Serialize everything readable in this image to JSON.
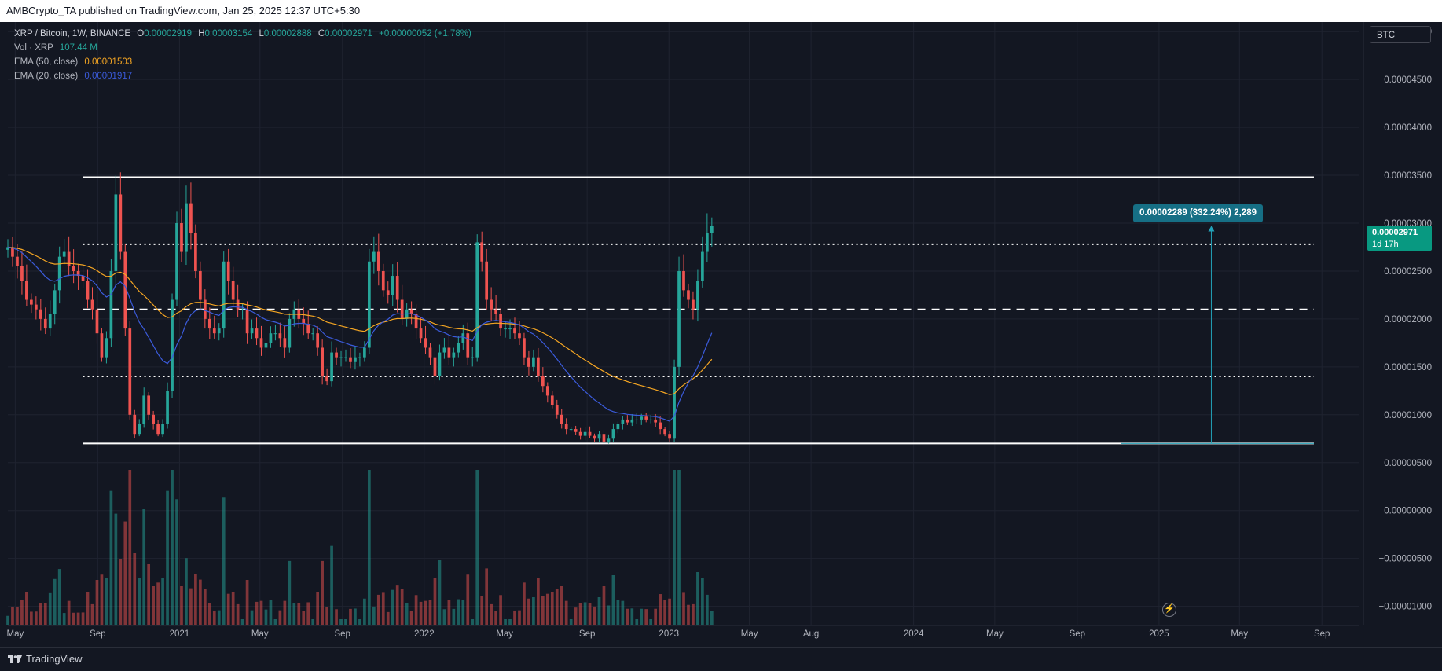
{
  "header": {
    "published": "AMBCrypto_TA published on TradingView.com, Jan 25, 2025 12:37 UTC+5:30"
  },
  "legend": {
    "symbol": "XRP / Bitcoin, 1W, BINANCE",
    "open_label": "O",
    "open": "0.00002919",
    "high_label": "H",
    "high": "0.00003154",
    "low_label": "L",
    "low": "0.00002888",
    "close_label": "C",
    "close": "0.00002971",
    "change": "+0.00000052 (+1.78%)",
    "vol_label": "Vol · XRP",
    "vol": "107.44 M",
    "ema50_label": "EMA (50, close)",
    "ema50": "0.00001503",
    "ema20_label": "EMA (20, close)",
    "ema20": "0.00001917"
  },
  "currency_button": "BTC",
  "price_tag": {
    "price": "0.00002971",
    "countdown": "1d 17h"
  },
  "measure": {
    "label": "0.00002289 (332.24%) 2,289",
    "value": 2.289e-05,
    "percent": 332.24,
    "bars": 2289
  },
  "footer": {
    "brand": "TradingView"
  },
  "colors": {
    "up": "#26a69a",
    "down": "#ef5350",
    "ema50": "#f5a623",
    "ema20": "#3b5bdb",
    "background": "#131722",
    "measure": "#22a2b9"
  },
  "chart_data": {
    "type": "candlestick",
    "title": "XRP / Bitcoin, 1W, BINANCE",
    "ylim": [
      -1.2e-05,
      5.1e-05
    ],
    "y_ticks": [
      "0.00005000",
      "0.00004500",
      "0.00004000",
      "0.00003500",
      "0.00003000",
      "0.00002500",
      "0.00002000",
      "0.00001500",
      "0.00001000",
      "0.00000500",
      "0.00000000",
      "−0.00000500",
      "−0.00001000"
    ],
    "y_tick_values": [
      5e-05,
      4.5e-05,
      4e-05,
      3.5e-05,
      3e-05,
      2.5e-05,
      2e-05,
      1.5e-05,
      1e-05,
      5e-06,
      0,
      -5e-06,
      -1e-05
    ],
    "x_range": [
      "2020-04-20",
      "2025-10-27"
    ],
    "x_ticks": [
      {
        "label": "May",
        "date": "2020-05-01"
      },
      {
        "label": "Sep",
        "date": "2020-09-01"
      },
      {
        "label": "2021",
        "date": "2021-01-01"
      },
      {
        "label": "May",
        "date": "2021-05-01"
      },
      {
        "label": "Sep",
        "date": "2021-09-01"
      },
      {
        "label": "2022",
        "date": "2022-01-01"
      },
      {
        "label": "May",
        "date": "2022-05-01"
      },
      {
        "label": "Sep",
        "date": "2022-09-01"
      },
      {
        "label": "2023",
        "date": "2023-01-01"
      },
      {
        "label": "May",
        "date": "2023-05-01"
      },
      {
        "label": "Aug",
        "date": "2023-08-01"
      },
      {
        "label": "2024",
        "date": "2024-01-01"
      },
      {
        "label": "May",
        "date": "2024-05-01"
      },
      {
        "label": "Sep",
        "date": "2024-09-01"
      },
      {
        "label": "2025",
        "date": "2025-01-01"
      },
      {
        "label": "May",
        "date": "2025-05-01"
      },
      {
        "label": "Sep",
        "date": "2025-09-01"
      }
    ],
    "series_dates": {
      "start": "2020-04-20",
      "interval": "1W"
    },
    "closes": [
      2.75e-05,
      2.65e-05,
      2.55e-05,
      2.4e-05,
      2.2e-05,
      2.15e-05,
      2.1e-05,
      2e-05,
      1.9e-05,
      2.05e-05,
      2.3e-05,
      2.65e-05,
      2.7e-05,
      2.55e-05,
      2.5e-05,
      2.45e-05,
      2.4e-05,
      2.2e-05,
      2.1e-05,
      1.85e-05,
      1.6e-05,
      1.8e-05,
      2.5e-05,
      3.3e-05,
      2.7e-05,
      1.9e-05,
      1e-05,
      8e-06,
      9e-06,
      1.2e-05,
      1e-05,
      9e-06,
      8e-06,
      9e-06,
      1.25e-05,
      2.2e-05,
      3e-05,
      2.7e-05,
      3.2e-05,
      2.9e-05,
      2.5e-05,
      2.2e-05,
      2e-05,
      1.9e-05,
      1.85e-05,
      1.9e-05,
      2.6e-05,
      2.4e-05,
      2.2e-05,
      2.1e-05,
      2.1e-05,
      1.85e-05,
      1.9e-05,
      1.8e-05,
      1.7e-05,
      1.75e-05,
      1.85e-05,
      1.85e-05,
      1.8e-05,
      1.7e-05,
      2e-05,
      2.1e-05,
      2e-05,
      1.95e-05,
      1.85e-05,
      1.85e-05,
      1.7e-05,
      1.4e-05,
      1.35e-05,
      1.65e-05,
      1.6e-05,
      1.6e-05,
      1.6e-05,
      1.55e-05,
      1.6e-05,
      1.6e-05,
      1.7e-05,
      2.6e-05,
      2.7e-05,
      2.5e-05,
      2.3e-05,
      2.25e-05,
      2.45e-05,
      2.2e-05,
      2e-05,
      2.1e-05,
      2.05e-05,
      1.9e-05,
      1.8e-05,
      1.7e-05,
      1.6e-05,
      1.4e-05,
      1.65e-05,
      1.7e-05,
      1.6e-05,
      1.65e-05,
      1.75e-05,
      1.85e-05,
      1.6e-05,
      1.6e-05,
      2.8e-05,
      2.6e-05,
      2.2e-05,
      2.1e-05,
      2.05e-05,
      1.9e-05,
      1.9e-05,
      1.9e-05,
      1.85e-05,
      1.8e-05,
      1.6e-05,
      1.5e-05,
      1.6e-05,
      1.4e-05,
      1.3e-05,
      1.2e-05,
      1.1e-05,
      1e-05,
      9e-06,
      8.5e-06,
      8.5e-06,
      8.2e-06,
      7.8e-06,
      8.2e-06,
      7.8e-06,
      7.5e-06,
      8e-06,
      7.2e-06,
      7.5e-06,
      8.5e-06,
      9e-06,
      9.5e-06,
      9.2e-06,
      9.5e-06,
      9.5e-06,
      9.8e-06,
      9.5e-06,
      9.5e-06,
      9.2e-06,
      8.5e-06,
      8e-06,
      7.5e-06,
      1.5e-05,
      2.5e-05,
      2.3e-05,
      2.2e-05,
      2.1e-05,
      2.4e-05,
      2.7e-05,
      2.9e-05,
      2.971e-05
    ],
    "ema50_end": 1.503e-05,
    "ema20_end": 1.917e-05,
    "horizontal_levels": [
      {
        "value": 3.48e-05,
        "style": "solid"
      },
      {
        "value": 2.78e-05,
        "style": "dotted"
      },
      {
        "value": 2.1e-05,
        "style": "dashed"
      },
      {
        "value": 1.4e-05,
        "style": "dotted"
      },
      {
        "value": 7e-06,
        "style": "solid"
      }
    ],
    "volume_axis_max_label": "107.44 M"
  }
}
